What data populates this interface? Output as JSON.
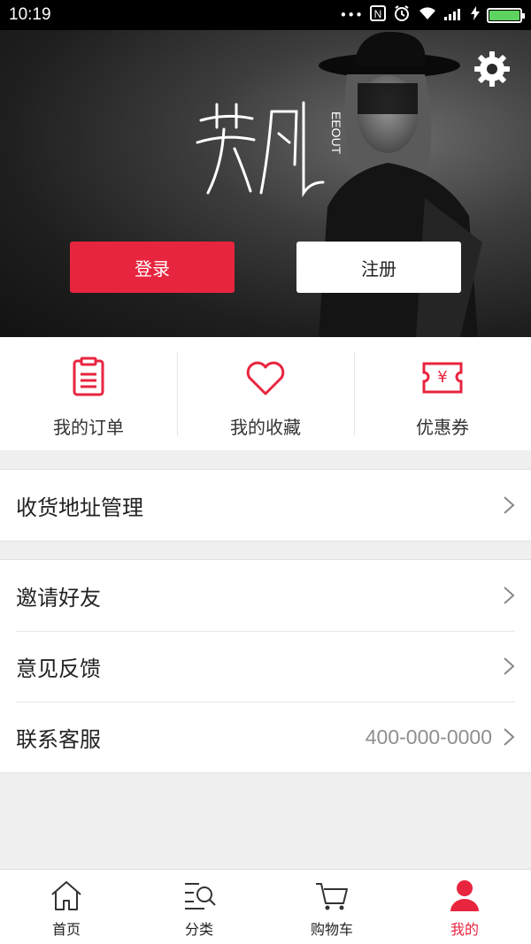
{
  "status_bar": {
    "time": "10:19",
    "dots": "•••",
    "nfc": "N"
  },
  "hero": {
    "login_label": "登录",
    "register_label": "注册"
  },
  "quick_actions": [
    {
      "label": "我的订单",
      "icon": "order-list-icon"
    },
    {
      "label": "我的收藏",
      "icon": "heart-icon"
    },
    {
      "label": "优惠券",
      "icon": "coupon-icon"
    }
  ],
  "menu": {
    "address": "收货地址管理",
    "invite": "邀请好友",
    "feedback": "意见反馈",
    "service": "联系客服",
    "service_phone": "400-000-0000"
  },
  "tabs": [
    {
      "label": "首页",
      "icon": "home-icon"
    },
    {
      "label": "分类",
      "icon": "category-icon"
    },
    {
      "label": "购物车",
      "icon": "cart-icon"
    },
    {
      "label": "我的",
      "icon": "user-icon",
      "active": true
    }
  ],
  "colors": {
    "accent": "#e8253f",
    "background": "#f0f0f0"
  }
}
